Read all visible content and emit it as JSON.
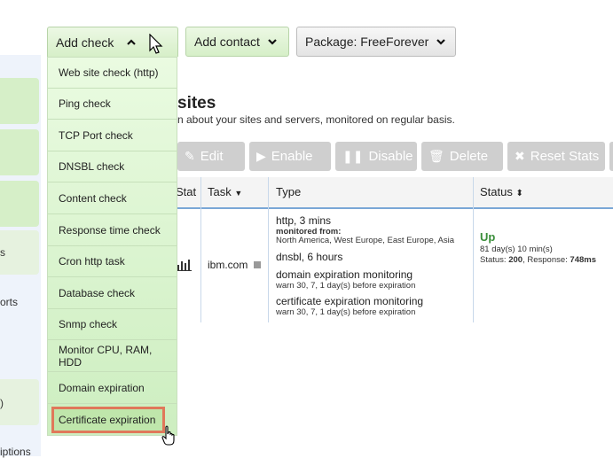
{
  "sidebar": {
    "fragments": [
      "s",
      "orts",
      ")",
      "iptions"
    ]
  },
  "topbar": {
    "add_check": "Add check",
    "add_contact": "Add contact",
    "package": "Package: FreeForever"
  },
  "dropdown": {
    "items": [
      "Web site check (http)",
      "Ping check",
      "TCP Port check",
      "DNSBL check",
      "Content check",
      "Response time check",
      "Cron http task",
      "Database check",
      "Snmp check",
      "Monitor CPU, RAM, HDD",
      "Domain expiration",
      "Certificate expiration"
    ]
  },
  "page": {
    "title": "sites",
    "subtitle": "n about your sites and servers, monitored on regular basis."
  },
  "actions": {
    "edit": "Edit",
    "enable": "Enable",
    "disable": "Disable",
    "delete": "Delete",
    "reset_stats": "Reset Stats"
  },
  "table": {
    "headers": {
      "stat": "Stat",
      "task": "Task",
      "type": "Type",
      "status": "Status"
    },
    "row": {
      "task": "ibm.com",
      "types": {
        "http": "http, 3 mins",
        "monitored_from_label": "monitored from:",
        "monitored_from": "North America, West Europe, East Europe, Asia",
        "dnsbl": "dnsbl, 6 hours",
        "domain_exp": "domain expiration monitoring",
        "domain_warn": "warn 30, 7, 1 day(s) before expiration",
        "cert_exp": "certificate expiration monitoring",
        "cert_warn": "warn 30, 7, 1 day(s) before expiration"
      },
      "status": {
        "state": "Up",
        "duration": "81 day(s) 10 min(s)",
        "status_label": "Status:",
        "status_code": "200",
        "response_label": ", Response:",
        "response_time": "748ms"
      }
    }
  },
  "colors": {
    "green_button": "#d6efc8",
    "highlight_outline": "#e0785a",
    "up_color": "#3a8e3a",
    "header_underline": "#7aa7d6"
  }
}
